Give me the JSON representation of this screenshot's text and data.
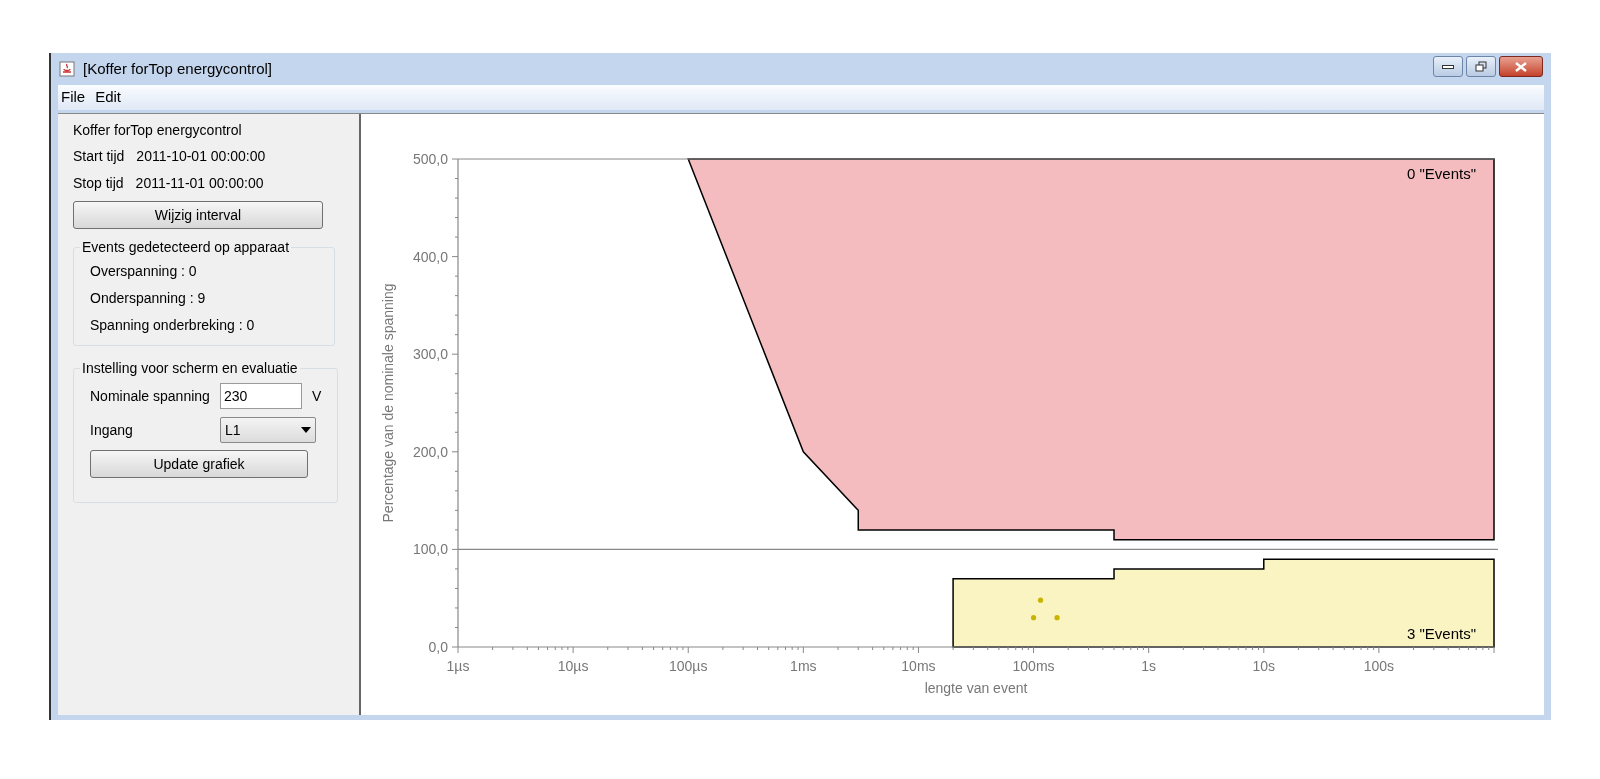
{
  "window": {
    "title": "[Koffer forTop energycontrol]"
  },
  "menu": [
    "File",
    "Edit"
  ],
  "sidebar": {
    "device": "Koffer forTop energycontrol",
    "times": [
      {
        "label": "Start tijd",
        "value": "2011-10-01 00:00:00"
      },
      {
        "label": "Stop tijd",
        "value": "2011-11-01 00:00:00"
      }
    ],
    "interval_button": "Wijzig interval",
    "events_group": {
      "title": "Events gedetecteerd op apparaat",
      "items": [
        "Overspanning : 0",
        "Onderspanning : 9",
        "Spanning onderbreking : 0"
      ]
    },
    "settings_group": {
      "title": "Instelling voor scherm en evaluatie",
      "voltage": {
        "label": "Nominale spanning",
        "value": "230",
        "unit": "V"
      },
      "input": {
        "label": "Ingang",
        "value": "L1"
      },
      "update_button": "Update grafiek"
    }
  },
  "chart": {
    "regions": [
      {
        "label": "0 \"Events\"",
        "color": "#f4bcbf"
      },
      {
        "label": "3 \"Events\"",
        "color": "#faf4c2"
      }
    ],
    "x_axis_title": "lengte van event",
    "y_axis_title": "Percentage van de nominale spanning",
    "x_tick_labels": [
      "1µs",
      "10µs",
      "100µs",
      "1ms",
      "10ms",
      "100ms",
      "1s",
      "10s",
      "100s"
    ],
    "y_tick_labels": [
      "500,0",
      "400,0",
      "300,0",
      "200,0",
      "100,0",
      "0,0"
    ]
  }
}
